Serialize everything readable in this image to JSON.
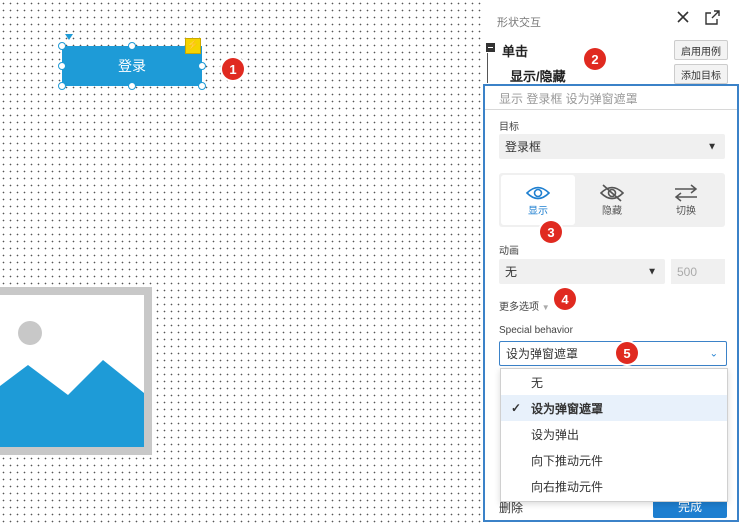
{
  "canvas": {
    "login_button_label": "登录",
    "lightning_icon": "lightning-icon",
    "markers": [
      "1",
      "2",
      "3",
      "4",
      "5"
    ]
  },
  "panel": {
    "title": "形状交互",
    "collapse_icon": "collapse-icon",
    "popout_icon": "popout-icon",
    "event_label": "单击",
    "action_label": "显示/隐藏",
    "enable_case_button": "启用用例",
    "add_target_button": "添加目标"
  },
  "action": {
    "summary": "显示 登录框 设为弹窗遮罩",
    "target_label": "目标",
    "target_value": "登录框",
    "visibility_options": [
      {
        "label": "显示",
        "icon": "eye-icon",
        "selected": true
      },
      {
        "label": "隐藏",
        "icon": "eye-off-icon",
        "selected": false
      },
      {
        "label": "切换",
        "icon": "swap-icon",
        "selected": false
      }
    ],
    "animation_label": "动画",
    "animation_value": "无",
    "duration_value": "500",
    "more_options_label": "更多选项",
    "special_behavior_label": "Special behavior",
    "special_behavior_value": "设为弹窗遮罩",
    "special_behavior_options": [
      "无",
      "设为弹窗遮罩",
      "设为弹出",
      "向下推动元件",
      "向右推动元件"
    ],
    "selected_option": "设为弹窗遮罩",
    "delete_label": "删除",
    "done_label": "完成"
  },
  "colors": {
    "accent": "#1e7fd0",
    "login_button": "#1e9bd7",
    "marker": "#e02a20",
    "panel_border": "#3b82c8"
  }
}
